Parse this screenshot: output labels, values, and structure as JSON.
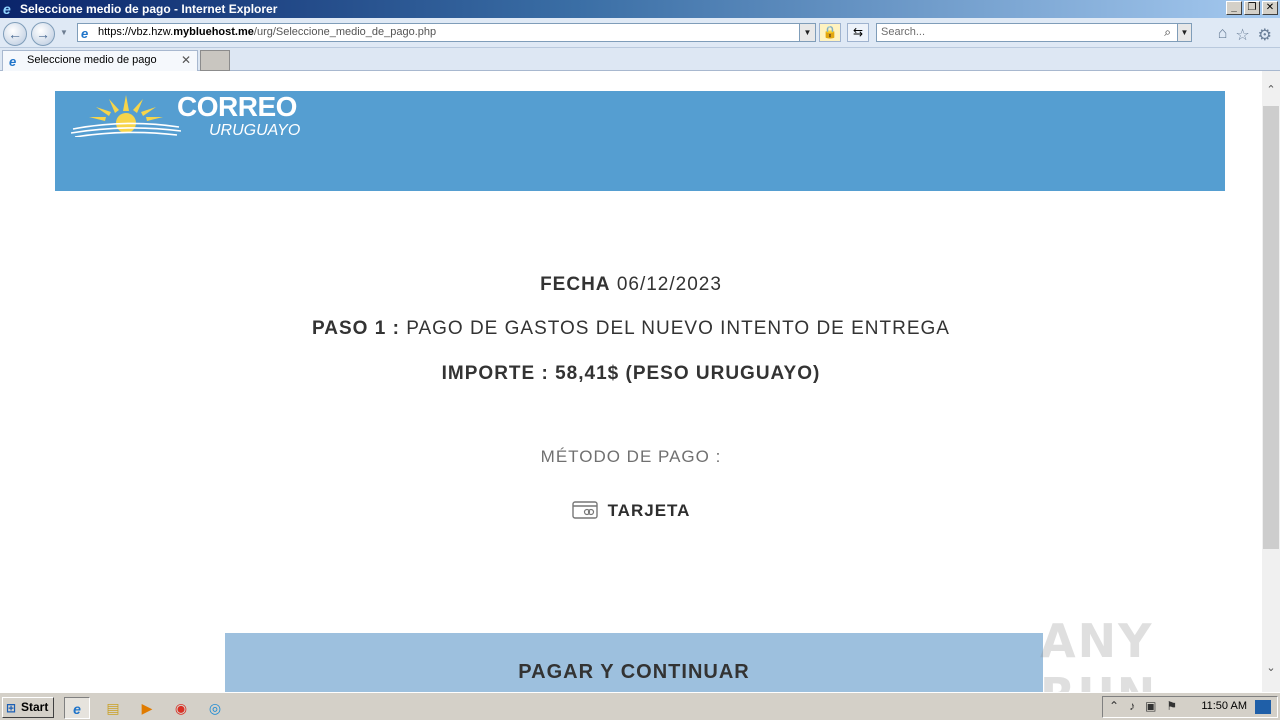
{
  "window": {
    "title": "Seleccione medio de pago - Internet Explorer",
    "minimize": "_",
    "restore": "❐",
    "close": "✕"
  },
  "navbar": {
    "url_prefix": "https://vbz.hzw.",
    "url_domain": "mybluehost.me",
    "url_path": "/urg/Seleccione_medio_de_pago.php",
    "search_placeholder": "Search..."
  },
  "tabs": [
    {
      "label": "Seleccione medio de pago"
    }
  ],
  "page": {
    "logo": {
      "title": "CORREO",
      "subtitle": "URUGUAYO"
    },
    "fecha": {
      "label": "FECHA",
      "value": "06/12/2023"
    },
    "paso": {
      "label": "PASO 1 :",
      "value": "PAGO DE GASTOS DEL NUEVO INTENTO DE ENTREGA"
    },
    "importe": "IMPORTE : 58,41$ (PESO URUGUAYO)",
    "metodo": "MÉTODO DE PAGO :",
    "tarjeta": "TARJETA",
    "pay_button": "PAGAR Y CONTINUAR"
  },
  "watermark": "ANY RUN",
  "taskbar": {
    "start": "Start",
    "clock": "11:50 AM"
  },
  "colors": {
    "banner": "#559ed1",
    "pay_button": "#9dc0de",
    "text": "#333333"
  }
}
